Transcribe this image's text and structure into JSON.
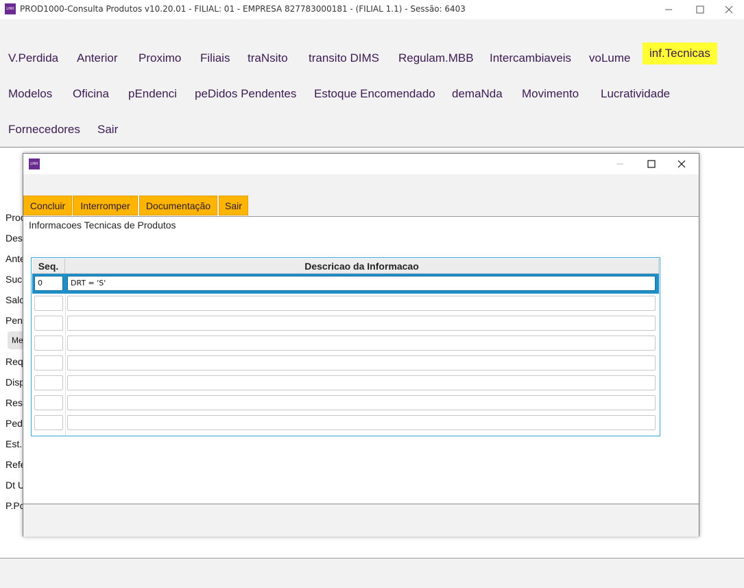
{
  "window": {
    "icon_text": "LINX",
    "title": "PROD1000-Consulta Produtos v10.20.01   - FILIAL: 01 - EMPRESA 827783000181 - (FILIAL 1.1) - Sessão: 6403"
  },
  "menu": {
    "items": [
      "V.Perdida",
      "Anterior",
      "Proximo",
      "Filiais",
      "traNsito",
      "transito DIMS",
      "Regulam.MBB",
      "Intercambiaveis",
      "voLume",
      "inf.Tecnicas",
      "Modelos",
      "Oficina",
      "pEndenci",
      "peDidos Pendentes",
      "Estoque Encomendado",
      "demaNda",
      "Movimento",
      "Lucratividade",
      "Fornecedores",
      "Sair"
    ],
    "highlighted": "inf.Tecnicas",
    "highlight_color": "#ffff33"
  },
  "background": {
    "labels": [
      "Proc",
      "Des",
      "Ante",
      "Suc",
      "Salc",
      "Pen",
      "Req",
      "Disp",
      "Res",
      "Ped",
      "Est.",
      "Refe",
      "Dt U",
      "P.Pc"
    ],
    "button_label": "Me"
  },
  "dialog": {
    "icon_text": "LINX",
    "buttons": [
      "Concluir",
      "Interromper",
      "Documentação",
      "Sair"
    ],
    "button_color": "#ffb400",
    "heading": "Informacoes Tecnicas de Produtos",
    "table": {
      "columns": [
        "Seq.",
        "Descricao da Informacao"
      ],
      "rows": [
        {
          "seq": "0",
          "desc": "DRT = 'S'"
        },
        {
          "seq": "",
          "desc": ""
        },
        {
          "seq": "",
          "desc": ""
        },
        {
          "seq": "",
          "desc": ""
        },
        {
          "seq": "",
          "desc": ""
        },
        {
          "seq": "",
          "desc": ""
        },
        {
          "seq": "",
          "desc": ""
        },
        {
          "seq": "",
          "desc": ""
        }
      ],
      "selected_row": 0,
      "selection_color": "#1f8fc7"
    }
  }
}
